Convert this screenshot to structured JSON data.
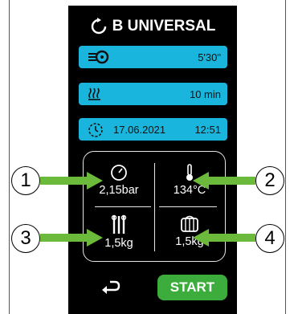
{
  "header": {
    "title": "B UNIVERSAL"
  },
  "bars": {
    "time": {
      "icon": "fan-heat-icon",
      "value": "5'30\""
    },
    "temperature_duration": {
      "icon": "heat-waves-icon",
      "value": "10 min"
    },
    "datetime": {
      "icon": "clock-icon",
      "date": "17.06.2021",
      "time": "12:51"
    }
  },
  "grid": {
    "pressure": {
      "icon": "pressure-gauge-icon",
      "value": "2,15bar"
    },
    "temperature": {
      "icon": "thermometer-icon",
      "value": "134°C"
    },
    "instruments": {
      "icon": "instruments-icon",
      "value": "1,5kg"
    },
    "textiles": {
      "icon": "textile-pack-icon",
      "value": "1,5kg"
    }
  },
  "footer": {
    "back_icon": "back-arrow-icon",
    "start_label": "START"
  },
  "callouts": [
    "1",
    "2",
    "3",
    "4"
  ],
  "colors": {
    "accent": "#1ab5dc",
    "start": "#3cad3c",
    "arrow": "#6cba3c",
    "screen": "#000000"
  }
}
